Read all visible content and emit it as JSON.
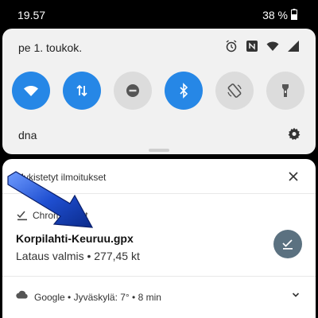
{
  "statusbar": {
    "time": "19.57",
    "battery": "38 %"
  },
  "quick_settings": {
    "date": "pe 1. toukok.",
    "tiles": [
      {
        "name": "wifi",
        "state": "on"
      },
      {
        "name": "mobile-data",
        "state": "on"
      },
      {
        "name": "do-not-disturb",
        "state": "off"
      },
      {
        "name": "bluetooth",
        "state": "on"
      },
      {
        "name": "auto-rotate",
        "state": "off"
      },
      {
        "name": "flashlight",
        "state": "off"
      }
    ],
    "operator": "dna"
  },
  "notifications": {
    "header": "Mykistetyt ilmoitukset",
    "download": {
      "app": "Chrome • nyt",
      "title": "Korpilahti-Keuruu.gpx",
      "subtitle": "Lataus valmis • 277,45 kt"
    },
    "weather": {
      "text": "Google • Jyväskylä: 7° • 8 min"
    }
  },
  "colors": {
    "accent": "#2687e6",
    "tile_off": "#dcdcdc",
    "action": "#5b7180",
    "arrow": "#1f4fd1"
  }
}
